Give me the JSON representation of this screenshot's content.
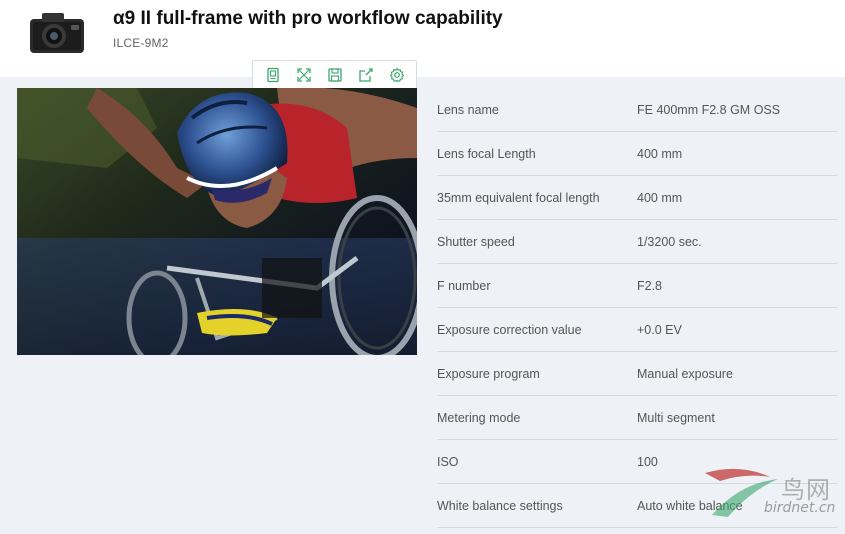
{
  "header": {
    "title": "α9 II full-frame with pro workflow capability",
    "model": "ILCE-9M2",
    "thumb_icon": "camera-icon"
  },
  "toolbar": {
    "buttons": [
      {
        "name": "bookmark",
        "icon": "document-icon"
      },
      {
        "name": "fullscreen",
        "icon": "expand-icon"
      },
      {
        "name": "save",
        "icon": "save-icon"
      },
      {
        "name": "share",
        "icon": "share-icon"
      },
      {
        "name": "settings",
        "icon": "gear-icon"
      }
    ],
    "accent_color": "#3aa76d"
  },
  "specs": [
    {
      "label": "Lens name",
      "value": "FE 400mm F2.8 GM OSS"
    },
    {
      "label": "Lens focal Length",
      "value": "400 mm"
    },
    {
      "label": "35mm equivalent focal length",
      "value": "400 mm"
    },
    {
      "label": "Shutter speed",
      "value": "1/3200 sec."
    },
    {
      "label": "F number",
      "value": "F2.8"
    },
    {
      "label": "Exposure correction value",
      "value": "+0.0 EV"
    },
    {
      "label": "Exposure program",
      "value": "Manual exposure"
    },
    {
      "label": "Metering mode",
      "value": "Multi segment"
    },
    {
      "label": "ISO",
      "value": "100"
    },
    {
      "label": "White balance settings",
      "value": "Auto white balance"
    }
  ],
  "watermark": {
    "cn_text": "鸟网",
    "url_text": "birdnet.cn"
  }
}
